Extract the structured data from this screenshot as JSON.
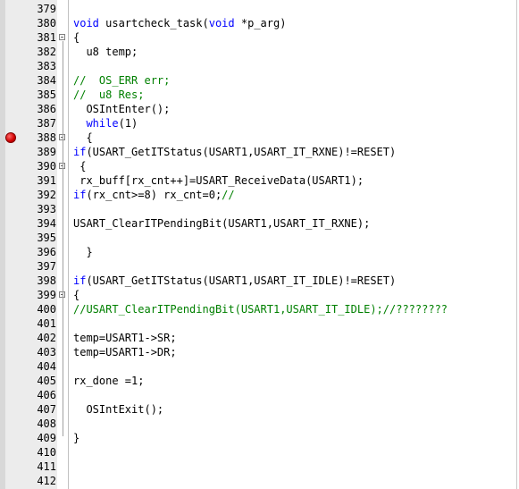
{
  "editor": {
    "lines": [
      {
        "num": "379",
        "tokens": []
      },
      {
        "num": "380",
        "tokens": [
          {
            "t": "kw",
            "v": "void"
          },
          {
            "t": "pl",
            "v": " usartcheck_task("
          },
          {
            "t": "kw",
            "v": "void"
          },
          {
            "t": "pl",
            "v": " *p_arg)"
          }
        ]
      },
      {
        "num": "381",
        "fold": true,
        "tokens": [
          {
            "t": "pl",
            "v": "{"
          }
        ]
      },
      {
        "num": "382",
        "tokens": [
          {
            "t": "pl",
            "v": "  u8 temp;"
          }
        ]
      },
      {
        "num": "383",
        "tokens": []
      },
      {
        "num": "384",
        "tokens": [
          {
            "t": "cm",
            "v": "//  OS_ERR err;"
          }
        ]
      },
      {
        "num": "385",
        "tokens": [
          {
            "t": "cm",
            "v": "//  u8 Res;"
          }
        ]
      },
      {
        "num": "386",
        "tokens": [
          {
            "t": "pl",
            "v": "  OSIntEnter();"
          }
        ]
      },
      {
        "num": "387",
        "tokens": [
          {
            "t": "pl",
            "v": "  "
          },
          {
            "t": "kw",
            "v": "while"
          },
          {
            "t": "pl",
            "v": "(1)"
          }
        ]
      },
      {
        "num": "388",
        "fold": true,
        "breakpoint": true,
        "tokens": [
          {
            "t": "pl",
            "v": "  {"
          }
        ]
      },
      {
        "num": "389",
        "tokens": [
          {
            "t": "kw",
            "v": "if"
          },
          {
            "t": "pl",
            "v": "(USART_GetITStatus(USART1,USART_IT_RXNE)!=RESET)"
          }
        ]
      },
      {
        "num": "390",
        "fold": true,
        "tokens": [
          {
            "t": "pl",
            "v": " {"
          }
        ]
      },
      {
        "num": "391",
        "tokens": [
          {
            "t": "pl",
            "v": " rx_buff[rx_cnt++]=USART_ReceiveData(USART1);"
          }
        ]
      },
      {
        "num": "392",
        "tokens": [
          {
            "t": "kw",
            "v": "if"
          },
          {
            "t": "pl",
            "v": "(rx_cnt>=8) rx_cnt=0;"
          },
          {
            "t": "cm",
            "v": "//"
          }
        ]
      },
      {
        "num": "393",
        "tokens": []
      },
      {
        "num": "394",
        "tokens": [
          {
            "t": "pl",
            "v": "USART_ClearITPendingBit(USART1,USART_IT_RXNE);"
          }
        ]
      },
      {
        "num": "395",
        "tokens": []
      },
      {
        "num": "396",
        "tokens": [
          {
            "t": "pl",
            "v": "  }"
          }
        ]
      },
      {
        "num": "397",
        "tokens": []
      },
      {
        "num": "398",
        "tokens": [
          {
            "t": "kw",
            "v": "if"
          },
          {
            "t": "pl",
            "v": "(USART_GetITStatus(USART1,USART_IT_IDLE)!=RESET)"
          }
        ]
      },
      {
        "num": "399",
        "fold": true,
        "tokens": [
          {
            "t": "pl",
            "v": "{"
          }
        ]
      },
      {
        "num": "400",
        "tokens": [
          {
            "t": "cm",
            "v": "//USART_ClearITPendingBit(USART1,USART_IT_IDLE);//????????"
          }
        ]
      },
      {
        "num": "401",
        "tokens": []
      },
      {
        "num": "402",
        "tokens": [
          {
            "t": "pl",
            "v": "temp=USART1->SR;"
          }
        ]
      },
      {
        "num": "403",
        "tokens": [
          {
            "t": "pl",
            "v": "temp=USART1->DR;"
          }
        ]
      },
      {
        "num": "404",
        "tokens": []
      },
      {
        "num": "405",
        "tokens": [
          {
            "t": "pl",
            "v": "rx_done =1;"
          }
        ]
      },
      {
        "num": "406",
        "tokens": []
      },
      {
        "num": "407",
        "tokens": [
          {
            "t": "pl",
            "v": "  OSIntExit();"
          }
        ]
      },
      {
        "num": "408",
        "tokens": []
      },
      {
        "num": "409",
        "tokens": [
          {
            "t": "pl",
            "v": "}"
          }
        ]
      },
      {
        "num": "410",
        "tokens": []
      },
      {
        "num": "411",
        "tokens": []
      },
      {
        "num": "412",
        "tokens": []
      }
    ]
  },
  "colors": {
    "keyword": "#0000ff",
    "comment": "#008000",
    "text": "#000000",
    "breakpoint": "#d00000"
  }
}
